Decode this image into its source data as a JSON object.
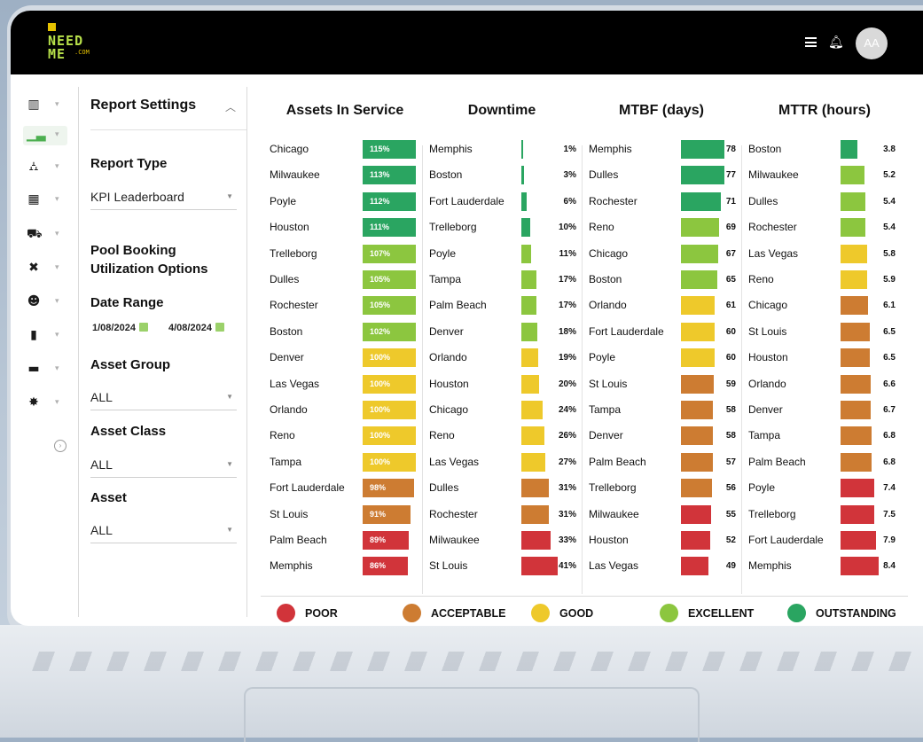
{
  "app": {
    "logo_line1": "NEED",
    "logo_line2": "ME",
    "logo_domain": ".COM",
    "user_initials": "AA"
  },
  "colors": {
    "poor": "#d1343a",
    "acceptable": "#cd7c32",
    "good": "#eec92b",
    "excellent": "#8cc63f",
    "outstanding": "#2aa561"
  },
  "rail": {
    "items": [
      {
        "icon": "map-icon"
      },
      {
        "icon": "chart-icon",
        "active": true
      },
      {
        "icon": "hierarchy-icon"
      },
      {
        "icon": "grid-icon"
      },
      {
        "icon": "car-icon"
      },
      {
        "icon": "tools-icon"
      },
      {
        "icon": "users-icon"
      },
      {
        "icon": "clipboard-icon"
      },
      {
        "icon": "folder-icon"
      },
      {
        "icon": "gear-icon"
      }
    ]
  },
  "settings": {
    "title": "Report Settings",
    "report_type_label": "Report Type",
    "report_type_value": "KPI Leaderboard",
    "pool_label_1": "Pool Booking",
    "pool_label_2": "Utilization Options",
    "date_range_label": "Date Range",
    "date_from": "1/08/2024",
    "date_to": "4/08/2024",
    "asset_group_label": "Asset Group",
    "asset_group_value": "ALL",
    "asset_class_label": "Asset Class",
    "asset_class_value": "ALL",
    "asset_label": "Asset",
    "asset_value": "ALL"
  },
  "board": {
    "columns": [
      {
        "title": "Assets In Service",
        "rows": [
          {
            "name": "Chicago",
            "value": "115%",
            "level": "outstanding",
            "fill": 0.93
          },
          {
            "name": "Milwaukee",
            "value": "113%",
            "level": "outstanding",
            "fill": 0.93
          },
          {
            "name": "Poyle",
            "value": "112%",
            "level": "outstanding",
            "fill": 0.93
          },
          {
            "name": "Houston",
            "value": "111%",
            "level": "outstanding",
            "fill": 0.93
          },
          {
            "name": "Trelleborg",
            "value": "107%",
            "level": "excellent",
            "fill": 0.93
          },
          {
            "name": "Dulles",
            "value": "105%",
            "level": "excellent",
            "fill": 0.93
          },
          {
            "name": "Rochester",
            "value": "105%",
            "level": "excellent",
            "fill": 0.93
          },
          {
            "name": "Boston",
            "value": "102%",
            "level": "excellent",
            "fill": 0.93
          },
          {
            "name": "Denver",
            "value": "100%",
            "level": "good",
            "fill": 0.93
          },
          {
            "name": "Las Vegas",
            "value": "100%",
            "level": "good",
            "fill": 0.93
          },
          {
            "name": "Orlando",
            "value": "100%",
            "level": "good",
            "fill": 0.93
          },
          {
            "name": "Reno",
            "value": "100%",
            "level": "good",
            "fill": 0.93
          },
          {
            "name": "Tampa",
            "value": "100%",
            "level": "good",
            "fill": 0.93
          },
          {
            "name": "Fort Lauderdale",
            "value": "98%",
            "level": "acceptable",
            "fill": 0.91
          },
          {
            "name": "St Louis",
            "value": "91%",
            "level": "acceptable",
            "fill": 0.84
          },
          {
            "name": "Palm Beach",
            "value": "89%",
            "level": "poor",
            "fill": 0.82
          },
          {
            "name": "Memphis",
            "value": "86%",
            "level": "poor",
            "fill": 0.79
          }
        ]
      },
      {
        "title": "Downtime",
        "rows": [
          {
            "name": "Memphis",
            "value": "1%",
            "level": "outstanding",
            "fill": 0.02
          },
          {
            "name": "Boston",
            "value": "3%",
            "level": "outstanding",
            "fill": 0.06
          },
          {
            "name": "Fort Lauderdale",
            "value": "6%",
            "level": "outstanding",
            "fill": 0.12
          },
          {
            "name": "Trelleborg",
            "value": "10%",
            "level": "outstanding",
            "fill": 0.2
          },
          {
            "name": "Poyle",
            "value": "11%",
            "level": "excellent",
            "fill": 0.22
          },
          {
            "name": "Tampa",
            "value": "17%",
            "level": "excellent",
            "fill": 0.34
          },
          {
            "name": "Palm Beach",
            "value": "17%",
            "level": "excellent",
            "fill": 0.34
          },
          {
            "name": "Denver",
            "value": "18%",
            "level": "excellent",
            "fill": 0.36
          },
          {
            "name": "Orlando",
            "value": "19%",
            "level": "good",
            "fill": 0.38
          },
          {
            "name": "Houston",
            "value": "20%",
            "level": "good",
            "fill": 0.4
          },
          {
            "name": "Chicago",
            "value": "24%",
            "level": "good",
            "fill": 0.48
          },
          {
            "name": "Reno",
            "value": "26%",
            "level": "good",
            "fill": 0.52
          },
          {
            "name": "Las Vegas",
            "value": "27%",
            "level": "good",
            "fill": 0.54
          },
          {
            "name": "Dulles",
            "value": "31%",
            "level": "acceptable",
            "fill": 0.62
          },
          {
            "name": "Rochester",
            "value": "31%",
            "level": "acceptable",
            "fill": 0.62
          },
          {
            "name": "Milwaukee",
            "value": "33%",
            "level": "poor",
            "fill": 0.66
          },
          {
            "name": "St Louis",
            "value": "41%",
            "level": "poor",
            "fill": 0.82
          }
        ]
      },
      {
        "title": "MTBF (days)",
        "rows": [
          {
            "name": "Memphis",
            "value": "78",
            "level": "outstanding",
            "fill": 1.0
          },
          {
            "name": "Dulles",
            "value": "77",
            "level": "outstanding",
            "fill": 0.99
          },
          {
            "name": "Rochester",
            "value": "71",
            "level": "outstanding",
            "fill": 0.91
          },
          {
            "name": "Reno",
            "value": "69",
            "level": "excellent",
            "fill": 0.88
          },
          {
            "name": "Chicago",
            "value": "67",
            "level": "excellent",
            "fill": 0.86
          },
          {
            "name": "Boston",
            "value": "65",
            "level": "excellent",
            "fill": 0.83
          },
          {
            "name": "Orlando",
            "value": "61",
            "level": "good",
            "fill": 0.78
          },
          {
            "name": "Fort Lauderdale",
            "value": "60",
            "level": "good",
            "fill": 0.77
          },
          {
            "name": "Poyle",
            "value": "60",
            "level": "good",
            "fill": 0.77
          },
          {
            "name": "St Louis",
            "value": "59",
            "level": "acceptable",
            "fill": 0.76
          },
          {
            "name": "Tampa",
            "value": "58",
            "level": "acceptable",
            "fill": 0.74
          },
          {
            "name": "Denver",
            "value": "58",
            "level": "acceptable",
            "fill": 0.74
          },
          {
            "name": "Palm Beach",
            "value": "57",
            "level": "acceptable",
            "fill": 0.73
          },
          {
            "name": "Trelleborg",
            "value": "56",
            "level": "acceptable",
            "fill": 0.72
          },
          {
            "name": "Milwaukee",
            "value": "55",
            "level": "poor",
            "fill": 0.7
          },
          {
            "name": "Houston",
            "value": "52",
            "level": "poor",
            "fill": 0.67
          },
          {
            "name": "Las Vegas",
            "value": "49",
            "level": "poor",
            "fill": 0.63
          }
        ]
      },
      {
        "title": "MTTR (hours)",
        "rows": [
          {
            "name": "Boston",
            "value": "3.8",
            "level": "outstanding",
            "fill": 0.45
          },
          {
            "name": "Milwaukee",
            "value": "5.2",
            "level": "excellent",
            "fill": 0.62
          },
          {
            "name": "Dulles",
            "value": "5.4",
            "level": "excellent",
            "fill": 0.64
          },
          {
            "name": "Rochester",
            "value": "5.4",
            "level": "excellent",
            "fill": 0.64
          },
          {
            "name": "Las Vegas",
            "value": "5.8",
            "level": "good",
            "fill": 0.69
          },
          {
            "name": "Reno",
            "value": "5.9",
            "level": "good",
            "fill": 0.7
          },
          {
            "name": "Chicago",
            "value": "6.1",
            "level": "acceptable",
            "fill": 0.73
          },
          {
            "name": "St Louis",
            "value": "6.5",
            "level": "acceptable",
            "fill": 0.77
          },
          {
            "name": "Houston",
            "value": "6.5",
            "level": "acceptable",
            "fill": 0.77
          },
          {
            "name": "Orlando",
            "value": "6.6",
            "level": "acceptable",
            "fill": 0.79
          },
          {
            "name": "Denver",
            "value": "6.7",
            "level": "acceptable",
            "fill": 0.8
          },
          {
            "name": "Tampa",
            "value": "6.8",
            "level": "acceptable",
            "fill": 0.81
          },
          {
            "name": "Palm Beach",
            "value": "6.8",
            "level": "acceptable",
            "fill": 0.81
          },
          {
            "name": "Poyle",
            "value": "7.4",
            "level": "poor",
            "fill": 0.88
          },
          {
            "name": "Trelleborg",
            "value": "7.5",
            "level": "poor",
            "fill": 0.89
          },
          {
            "name": "Fort Lauderdale",
            "value": "7.9",
            "level": "poor",
            "fill": 0.94
          },
          {
            "name": "Memphis",
            "value": "8.4",
            "level": "poor",
            "fill": 1.0
          }
        ]
      }
    ]
  },
  "legend": [
    {
      "label": "POOR",
      "level": "poor"
    },
    {
      "label": "ACCEPTABLE",
      "level": "acceptable"
    },
    {
      "label": "GOOD",
      "level": "good"
    },
    {
      "label": "EXCELLENT",
      "level": "excellent"
    },
    {
      "label": "OUTSTANDING",
      "level": "outstanding"
    }
  ]
}
